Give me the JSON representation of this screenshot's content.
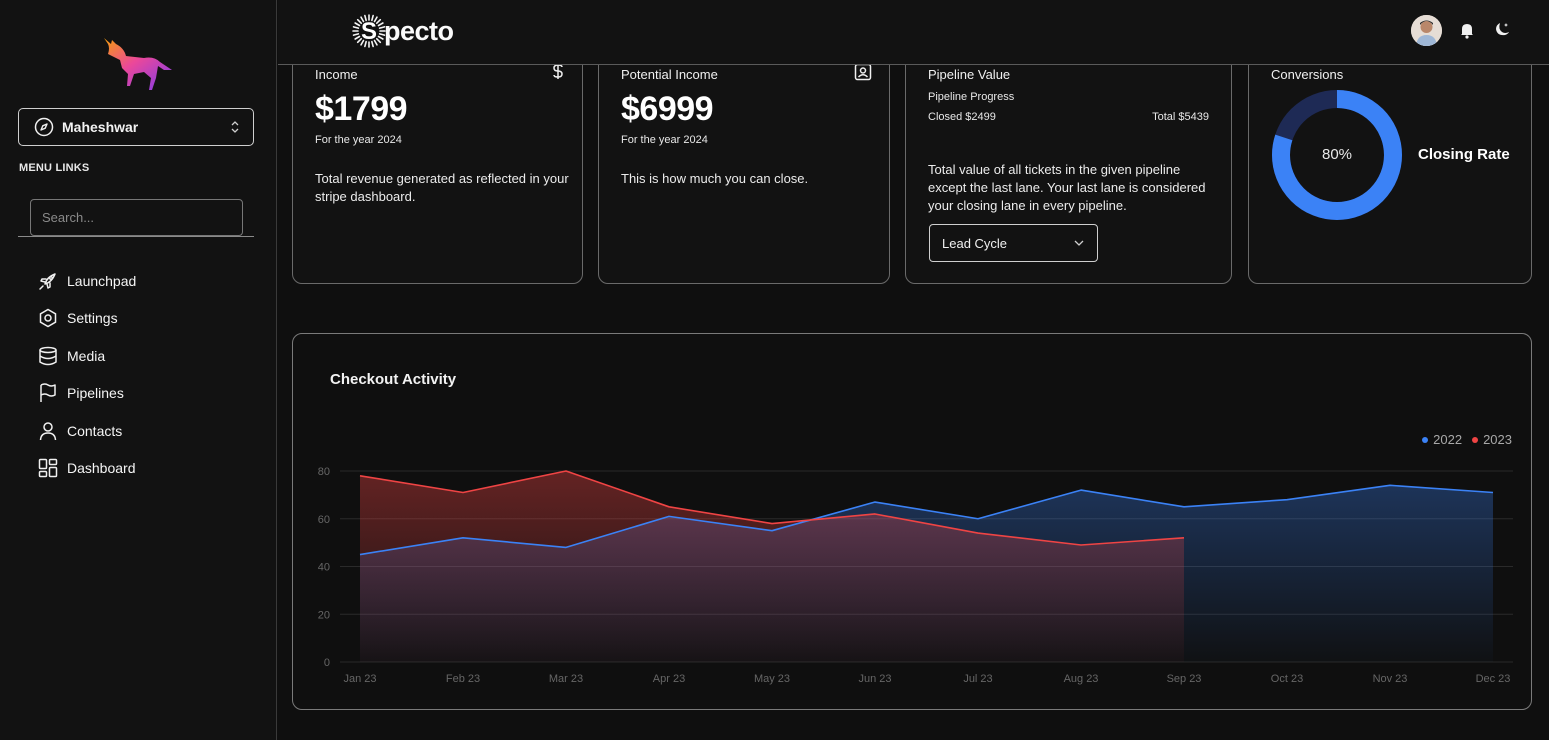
{
  "sidebar": {
    "account_name": "Maheshwar",
    "menu_title": "MENU LINKS",
    "search_placeholder": "Search...",
    "items": [
      {
        "label": "Launchpad",
        "icon": "rocket-icon"
      },
      {
        "label": "Settings",
        "icon": "settings-hexagon-icon"
      },
      {
        "label": "Media",
        "icon": "database-icon"
      },
      {
        "label": "Pipelines",
        "icon": "flag-icon"
      },
      {
        "label": "Contacts",
        "icon": "user-icon"
      },
      {
        "label": "Dashboard",
        "icon": "dashboard-grid-icon"
      }
    ]
  },
  "header": {
    "brand": "pecto",
    "brand_initial": "S"
  },
  "cards": {
    "income": {
      "title": "Income",
      "value": "$1799",
      "period": "For the year 2024",
      "description": "Total revenue generated as reflected in your stripe dashboard.",
      "icon": "dollar-icon"
    },
    "potential": {
      "title": "Potential Income",
      "value": "$6999",
      "period": "For the year 2024",
      "description": "This is how much you can close.",
      "icon": "contact-card-icon"
    },
    "pipeline": {
      "title": "Pipeline Value",
      "progress_label": "Pipeline Progress",
      "closed": "Closed $2499",
      "total": "Total $5439",
      "description": "Total value of all tickets in the given pipeline except the last lane. Your last lane is considered your closing lane in every pipeline.",
      "select_value": "Lead Cycle"
    },
    "conversions": {
      "title": "Conversions",
      "percent_label": "80%",
      "percent": 80,
      "caption": "Closing Rate"
    }
  },
  "colors": {
    "accent_blue": "#3b82f6",
    "accent_red": "#ef4444",
    "ring_track": "#1e2a55"
  },
  "chart_data": {
    "type": "area",
    "title": "Checkout Activity",
    "categories": [
      "Jan 23",
      "Feb 23",
      "Mar 23",
      "Apr 23",
      "May 23",
      "Jun 23",
      "Jul 23",
      "Aug 23",
      "Sep 23",
      "Oct 23",
      "Nov 23",
      "Dec 23"
    ],
    "series": [
      {
        "name": "2022",
        "color": "#3b82f6",
        "values": [
          45,
          52,
          48,
          61,
          55,
          67,
          60,
          72,
          65,
          68,
          74,
          71
        ]
      },
      {
        "name": "2023",
        "color": "#ef4444",
        "values": [
          78,
          71,
          80,
          65,
          58,
          62,
          54,
          49,
          52
        ]
      }
    ],
    "yticks": [
      0,
      20,
      40,
      60,
      80
    ],
    "ylim": [
      0,
      80
    ],
    "grid": true,
    "legend": "top-right"
  }
}
